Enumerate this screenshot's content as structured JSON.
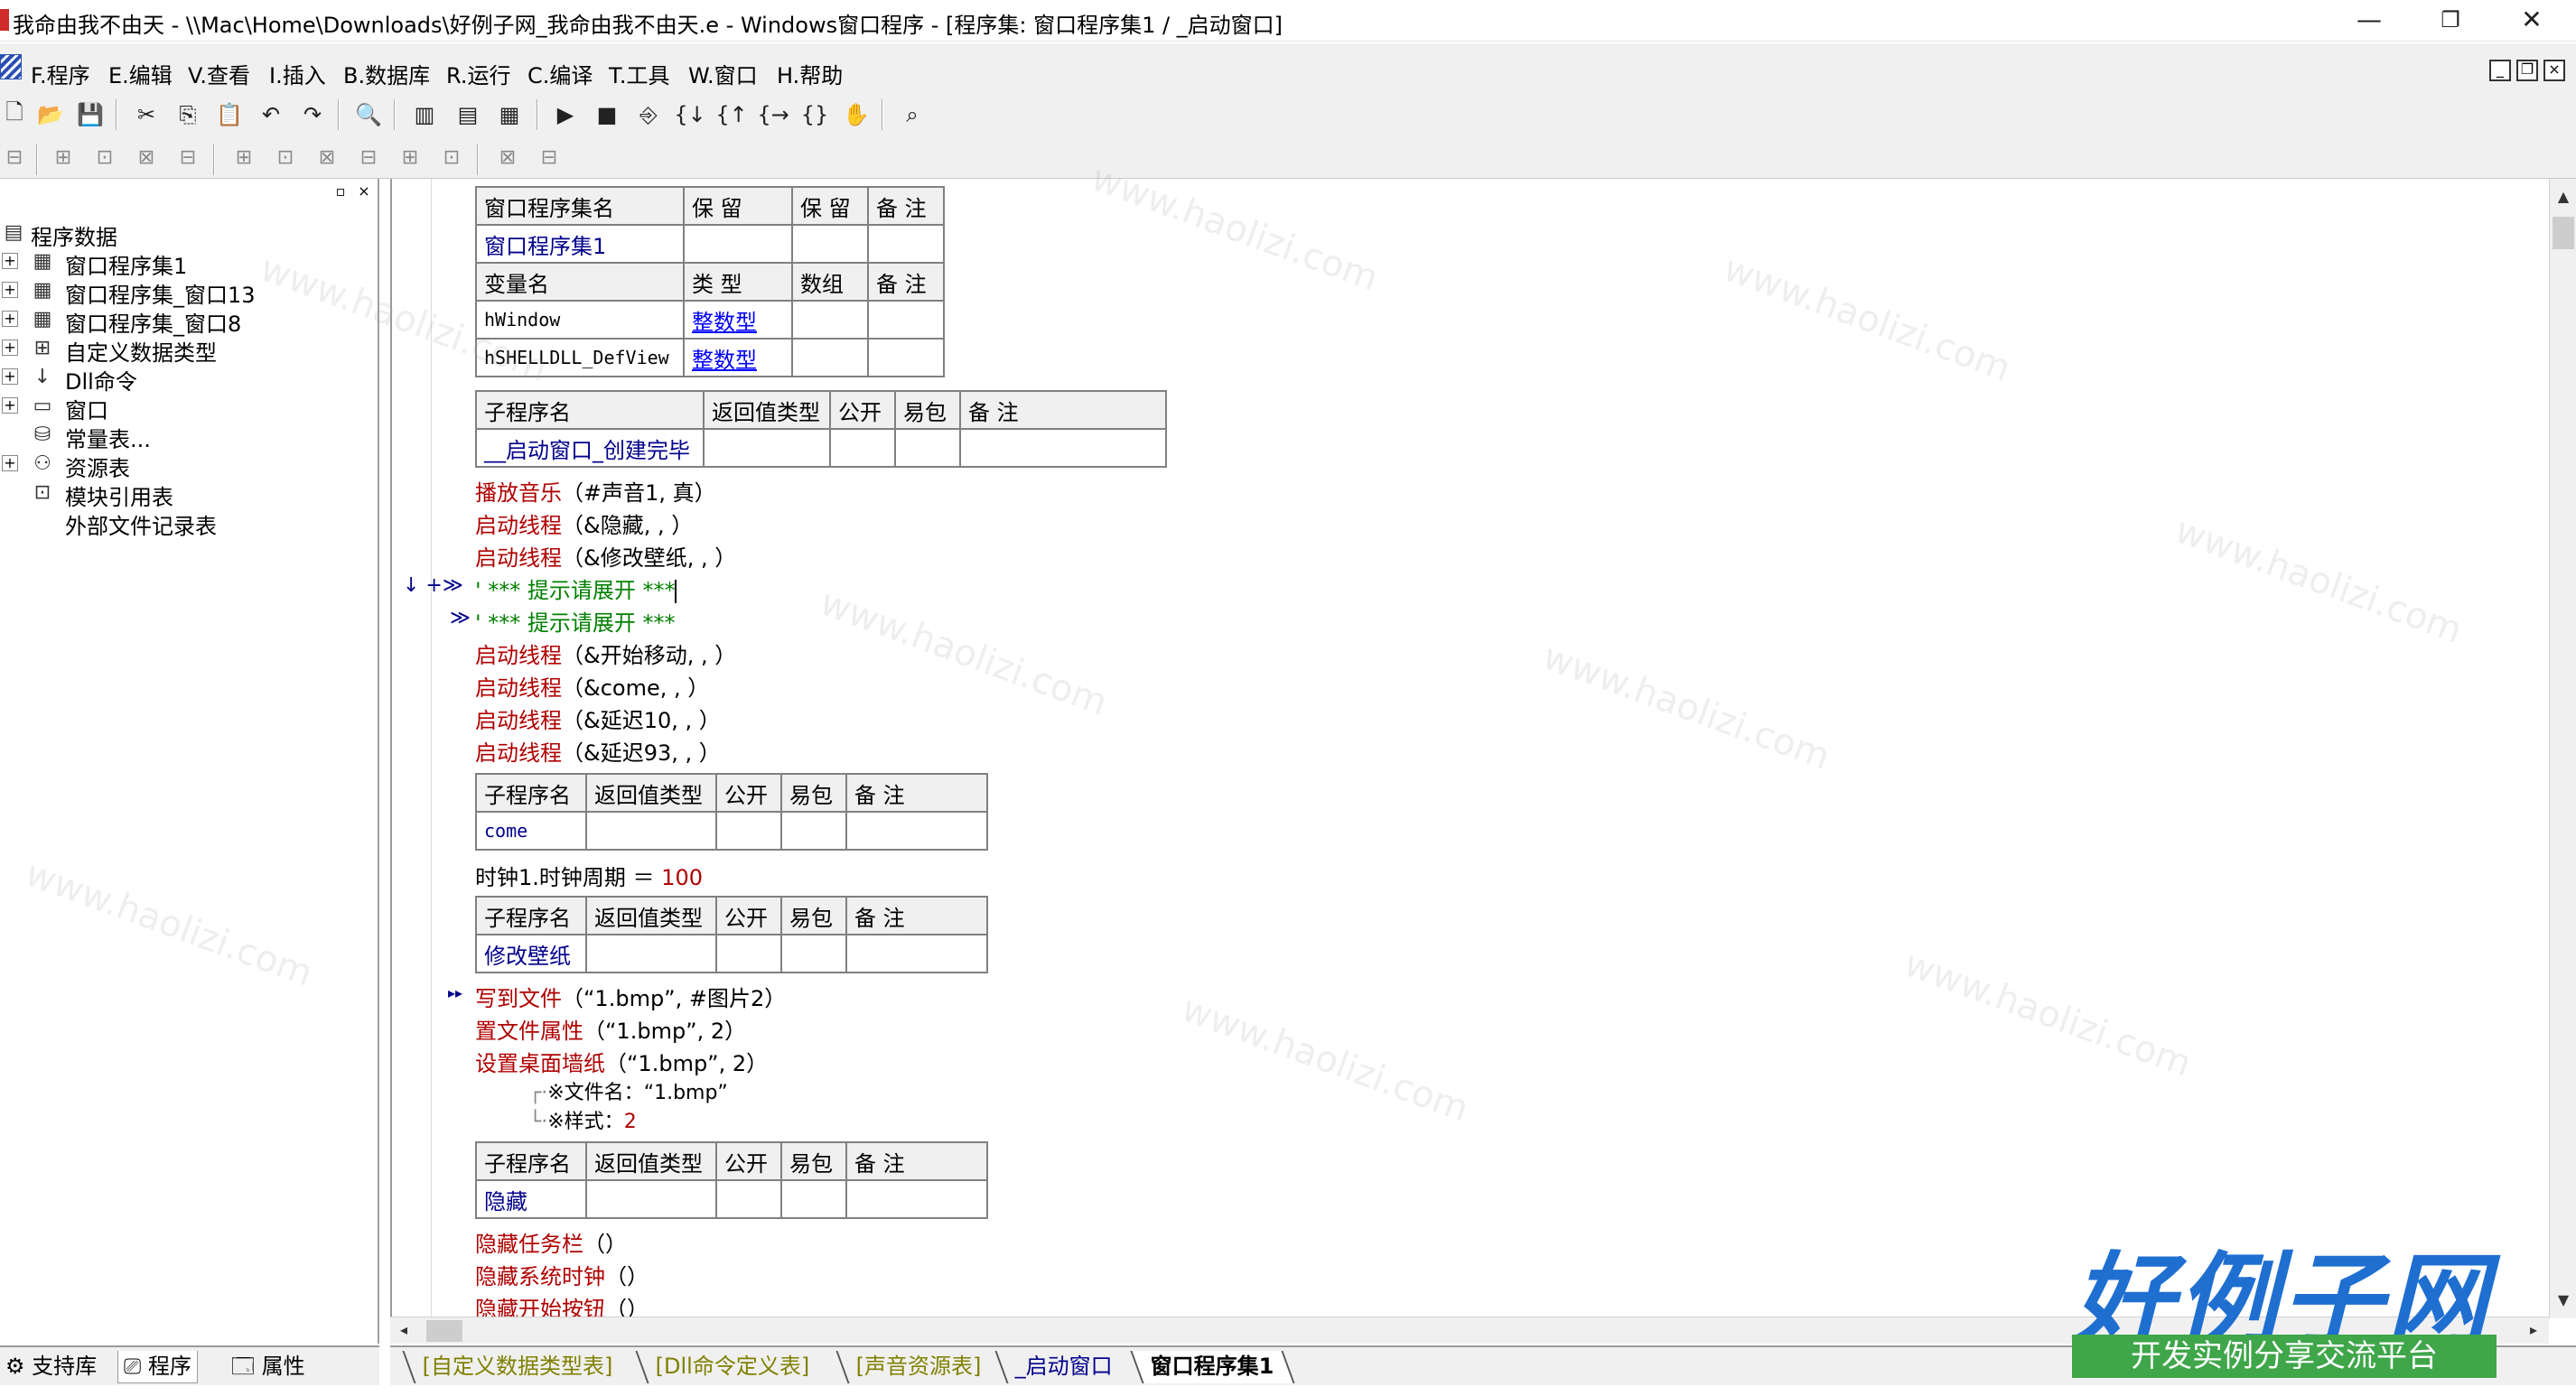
{
  "window": {
    "title": "我命由我不由天 - \\\\Mac\\Home\\Downloads\\好例子网_我命由我不由天.e - Windows窗口程序 - [程序集: 窗口程序集1 / _启动窗口]",
    "minimize": "—",
    "maximize": "❐",
    "close": "✕"
  },
  "menu": {
    "items": [
      "F.程序",
      "E.编辑",
      "V.查看",
      "I.插入",
      "B.数据库",
      "R.运行",
      "C.编译",
      "T.工具",
      "W.窗口",
      "H.帮助"
    ],
    "mdi_minimize": "_",
    "mdi_restore": "❐",
    "mdi_close": "×"
  },
  "toolbar1": {
    "icons": [
      "new-file-icon",
      "open-folder-icon",
      "save-icon",
      "cut-icon",
      "copy-icon",
      "paste-icon",
      "undo-icon",
      "redo-icon",
      "find-icon",
      "layout-1-icon",
      "layout-2-icon",
      "layout-3-icon",
      "run-icon",
      "stop-icon",
      "step-icon",
      "step-in-icon",
      "step-out-icon",
      "step-over-icon",
      "braces-icon",
      "hand-icon",
      "binoculars-icon"
    ],
    "glyphs": [
      "🗋",
      "📂",
      "💾",
      "✂",
      "⎘",
      "📋",
      "↶",
      "↷",
      "🔍",
      "▥",
      "▤",
      "▦",
      "▶",
      "■",
      "⎆",
      "{↓",
      "{↑",
      "{→",
      "{}",
      "✋",
      "⌕"
    ]
  },
  "toolbar2": {
    "glyphs": [
      "⊟",
      "⊞",
      "⊡",
      "⊠",
      "⊟",
      "⊞",
      "⊡",
      "⊠",
      "⊟",
      "⊞",
      "⊡",
      "⊠",
      "⊟"
    ]
  },
  "left_panel": {
    "pin": "▫",
    "close": "×",
    "tree": [
      {
        "label": "程序数据",
        "icon": "▤",
        "level": 0,
        "expander": ""
      },
      {
        "label": "窗口程序集1",
        "icon": "▦",
        "level": 1,
        "expander": "+"
      },
      {
        "label": "窗口程序集_窗口13",
        "icon": "▦",
        "level": 1,
        "expander": "+"
      },
      {
        "label": "窗口程序集_窗口8",
        "icon": "▦",
        "level": 1,
        "expander": "+"
      },
      {
        "label": "自定义数据类型",
        "icon": "⊞",
        "level": 1,
        "expander": "+"
      },
      {
        "label": "Dll命令",
        "icon": "↓",
        "level": 1,
        "expander": "+"
      },
      {
        "label": "窗口",
        "icon": "▭",
        "level": 1,
        "expander": "+"
      },
      {
        "label": "常量表...",
        "icon": "⛁",
        "level": 1,
        "expander": ""
      },
      {
        "label": "资源表",
        "icon": "⚇",
        "level": 1,
        "expander": "+"
      },
      {
        "label": "模块引用表",
        "icon": "⊡",
        "level": 1,
        "expander": ""
      },
      {
        "label": "外部文件记录表",
        "icon": "",
        "level": 1,
        "expander": ""
      }
    ],
    "tabs": [
      "支持库",
      "程序",
      "属性"
    ]
  },
  "editor": {
    "assembly_table": {
      "header1": [
        "窗口程序集名",
        "保 留",
        "保 留",
        "备 注"
      ],
      "row1": [
        "窗口程序集1",
        "",
        "",
        ""
      ],
      "header2": [
        "变量名",
        "类 型",
        "数组",
        "备 注"
      ],
      "vars": [
        {
          "name": "hWindow",
          "type": "整数型",
          "array": "",
          "note": ""
        },
        {
          "name": "hSHELLDLL_DefView",
          "type": "整数型",
          "array": "",
          "note": ""
        }
      ]
    },
    "sub_headers": [
      "子程序名",
      "返回值类型",
      "公开",
      "易包",
      "备 注"
    ],
    "sub1": {
      "name": "__启动窗口_创建完毕"
    },
    "sub1_lines": [
      {
        "fn": "播放音乐",
        "args": "（#声音1, 真）"
      },
      {
        "fn": "启动线程",
        "args": "（&隐藏, , ）"
      },
      {
        "fn": "启动线程",
        "args": "（&修改壁纸, , ）"
      }
    ],
    "fold_lines": [
      "' *** 提示请展开 ***",
      "' *** 提示请展开 ***"
    ],
    "fold_markers": [
      "↓ +≫",
      "≫"
    ],
    "sub1_lines_b": [
      {
        "fn": "启动线程",
        "args": "（&开始移动, , ）"
      },
      {
        "fn": "启动线程",
        "args": "（&come, , ）"
      },
      {
        "fn": "启动线程",
        "args": "（&延迟10, , ）"
      },
      {
        "fn": "启动线程",
        "args": "（&延迟93, , ）"
      }
    ],
    "sub2": {
      "name": "come"
    },
    "sub2_line": {
      "target": "时钟1.时钟周期",
      "op": " ＝ ",
      "value": "100"
    },
    "sub3": {
      "name": "修改壁纸"
    },
    "sub3_marker": "▸▸",
    "sub3_lines": [
      {
        "fn": "写到文件",
        "args": "（“1.bmp”, #图片2）"
      },
      {
        "fn": "置文件属性",
        "args": "（“1.bmp”, 2）"
      },
      {
        "fn": "设置桌面墙纸",
        "args": "（“1.bmp”, 2）"
      }
    ],
    "sub3_hints": [
      {
        "tree": "┌·",
        "label": "※文件名：",
        "value": "“1.bmp”"
      },
      {
        "tree": "└·",
        "label": "※样式：",
        "value": "2"
      }
    ],
    "sub4": {
      "name": "隐藏"
    },
    "sub4_lines": [
      {
        "fn": "隐藏任务栏",
        "args": "（）"
      },
      {
        "fn": "隐藏系统时钟",
        "args": "（）"
      },
      {
        "fn": "隐藏开始按钮",
        "args": "（）"
      }
    ]
  },
  "scrollbar": {
    "up": "▲",
    "down": "▼",
    "left": "◂",
    "right": "▸"
  },
  "bottom_tabs": [
    "[自定义数据类型表]",
    "[Dll命令定义表]",
    "[声音资源表]",
    "_启动窗口",
    "窗口程序集1"
  ],
  "logo": {
    "main": "好例子网",
    "sub": "开发实例分享交流平台"
  },
  "watermark": "www.haolizi.com",
  "colors": {
    "keyword": "#b00000",
    "comment": "#008000",
    "link": "#0000ff",
    "value": "#00008b",
    "logo_blue": "#1f6fd1",
    "logo_green": "#3fa64a"
  }
}
